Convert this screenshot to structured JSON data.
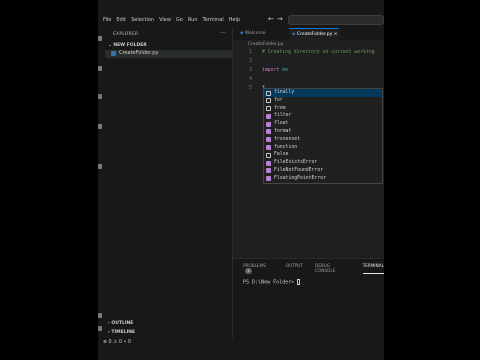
{
  "menu": [
    "File",
    "Edit",
    "Selection",
    "View",
    "Go",
    "Run",
    "Terminal",
    "Help"
  ],
  "nav": {
    "back": "←",
    "forward": "→"
  },
  "explorer": {
    "title": "EXPLORER",
    "folder": "NEW FOLDER",
    "file": "CreateFolder.py",
    "outline": "OUTLINE",
    "timeline": "TIMELINE"
  },
  "tabs": [
    "Welcome",
    "CreateFolder.py"
  ],
  "breadcrumb": "CreateFolder.py",
  "code": [
    {
      "n": "1",
      "t": "# Creating directory on current working",
      "c": "comment"
    },
    {
      "n": "2",
      "t": "",
      "c": ""
    },
    {
      "n": "3",
      "t": "import os",
      "c": "import"
    },
    {
      "n": "4",
      "t": "",
      "c": ""
    },
    {
      "n": "5",
      "t": "f",
      "c": ""
    }
  ],
  "suggestions": [
    {
      "label": "finally",
      "kind": "keyword"
    },
    {
      "label": "for",
      "kind": "keyword"
    },
    {
      "label": "from",
      "kind": "keyword"
    },
    {
      "label": "filter",
      "kind": "class"
    },
    {
      "label": "float",
      "kind": "class"
    },
    {
      "label": "format",
      "kind": "class"
    },
    {
      "label": "frozenset",
      "kind": "class"
    },
    {
      "label": "function",
      "kind": "class"
    },
    {
      "label": "False",
      "kind": "keyword"
    },
    {
      "label": "FileExistsError",
      "kind": "class"
    },
    {
      "label": "FileNotFoundError",
      "kind": "class"
    },
    {
      "label": "FloatingPointError",
      "kind": "class"
    }
  ],
  "panel": {
    "tabs": [
      "PROBLEMS",
      "OUTPUT",
      "DEBUG CONSOLE",
      "TERMINAL"
    ],
    "problems_count": "3",
    "prompt": "PS D:\\New Folder>"
  },
  "status": "⊗ 0 ⚠ 0  ⑂ 0",
  "colors": {
    "accent": "#0078d4",
    "selection": "#04395e"
  }
}
